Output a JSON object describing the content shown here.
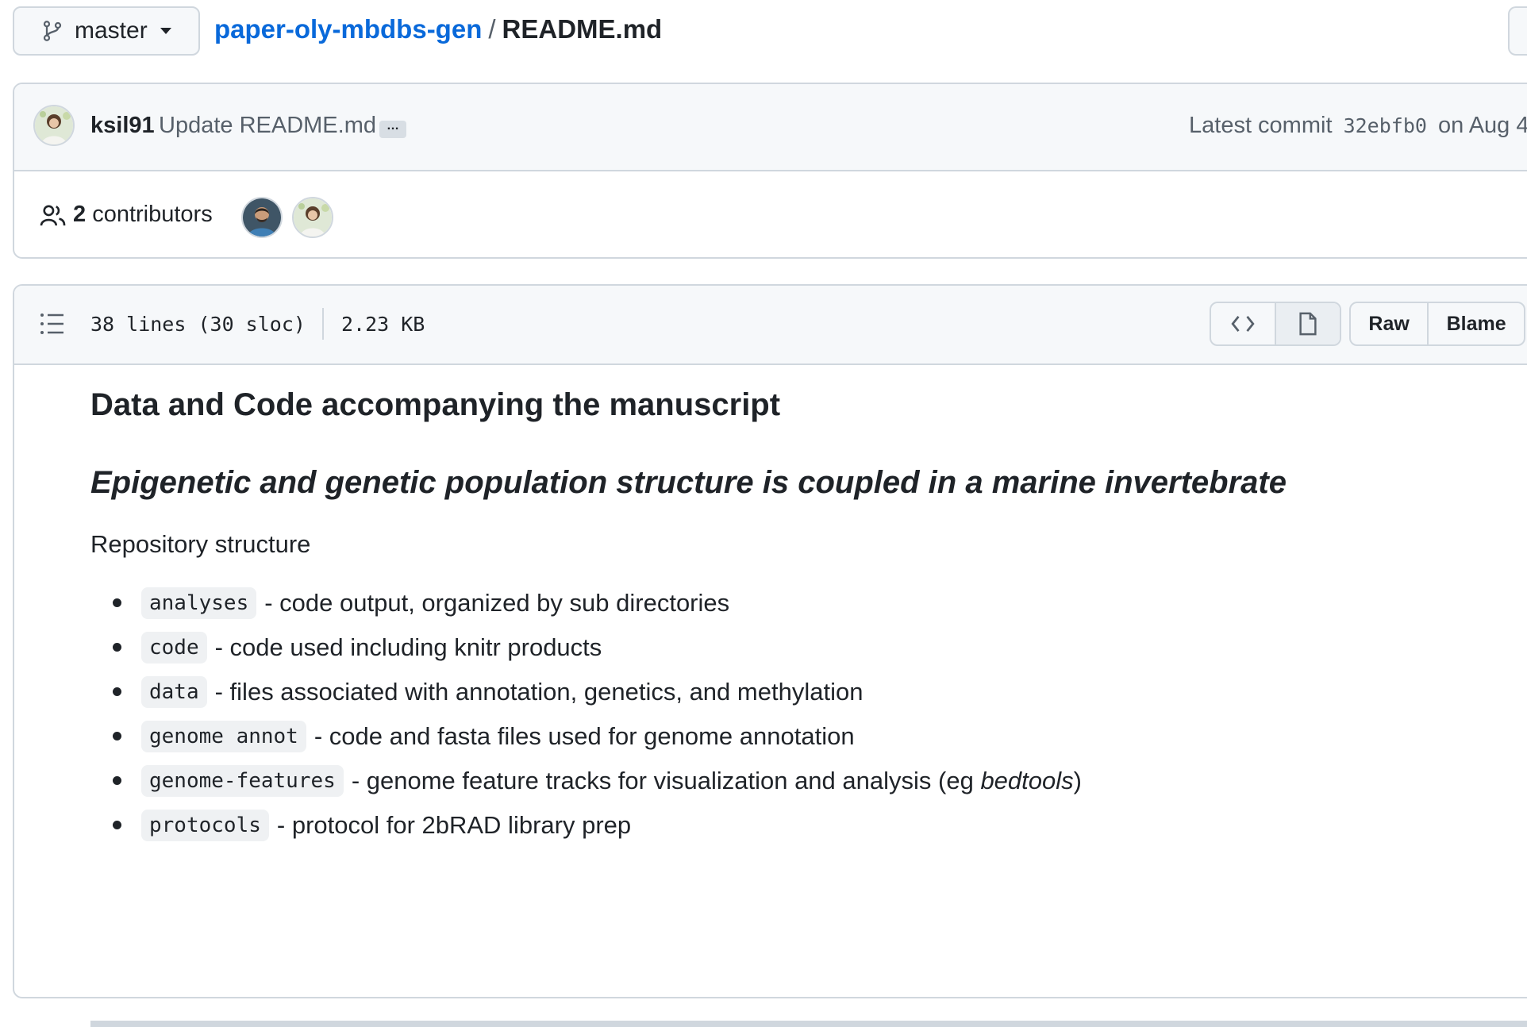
{
  "header": {
    "branch": "master",
    "repo": "paper-oly-mbdbs-gen",
    "separator": "/",
    "file": "README.md"
  },
  "commit": {
    "author": "ksil91",
    "message": "Update README.md",
    "ellipsis": "…",
    "latest_prefix": "Latest commit",
    "sha": "32ebfb0",
    "date_text": "on Aug 4,"
  },
  "contributors": {
    "count": "2",
    "label": "contributors"
  },
  "file_info": {
    "lines": "38 lines (30 sloc)",
    "size": "2.23 KB",
    "raw_label": "Raw",
    "blame_label": "Blame"
  },
  "readme": {
    "heading": "Data and Code accompanying the manuscript",
    "subheading": "Epigenetic and genetic population structure is coupled in a marine invertebrate",
    "paragraph": "Repository structure",
    "items": [
      {
        "code": "analyses",
        "desc": "- code output, organized by sub directories"
      },
      {
        "code": "code",
        "desc": "- code used including knitr products"
      },
      {
        "code": "data",
        "desc": "- files associated with annotation, genetics, and methylation"
      },
      {
        "code": "genome annot",
        "desc": "- code and fasta files used for genome annotation"
      },
      {
        "code": "genome-features",
        "desc": "- genome feature tracks for visualization and analysis (eg ",
        "desc_em": "bedtools",
        "desc_end": ")"
      },
      {
        "code": "protocols",
        "desc": "- protocol for 2bRAD library prep"
      }
    ]
  },
  "colors": {
    "link": "#0969da",
    "border": "#d0d7de",
    "header_bg": "#f6f8fa",
    "text": "#1f2328",
    "muted": "#57606a"
  },
  "icons": [
    "git-branch-icon",
    "caret-down-icon",
    "people-icon",
    "list-unordered-icon",
    "code-icon",
    "file-icon"
  ]
}
